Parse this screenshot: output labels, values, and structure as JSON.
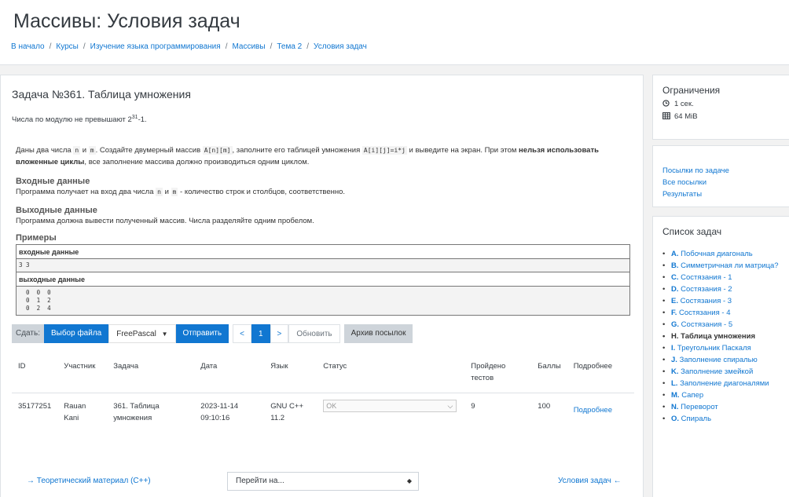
{
  "header": {
    "title": "Массивы: Условия задач",
    "breadcrumb": [
      "В начало",
      "Курсы",
      "Изучение языка программирования",
      "Массивы",
      "Тема 2",
      "Условия задач"
    ]
  },
  "task": {
    "title": "Задача №361. Таблица умножения",
    "note_prefix": "Числа по модулю не превышают 2",
    "note_exp": "31",
    "note_suffix": "-1.",
    "statement_parts": {
      "p1a": "Даны два числа ",
      "n": "n",
      "p1b": " и ",
      "m": "m",
      "p1c": ". Создайте двумерный массив ",
      "arr": "A[n][m]",
      "p1d": ", заполните его таблицей умножения ",
      "formula": "A[i][j]=i*j",
      "p1e": " и выведите на экран. При этом ",
      "bold": "нельзя использовать вложенные циклы",
      "p1f": ", все заполнение массива должно производиться одним циклом."
    },
    "input_title": "Входные данные",
    "input_parts": {
      "a": "Программа получает на вход два числа ",
      "n": "n",
      "b": " и ",
      "m": "m",
      "c": " - количество строк и столбцов, соответственно."
    },
    "output_title": "Выходные данные",
    "output_text": "Программа должна вывести  полученный массив. Числа разделяйте одним пробелом.",
    "examples_title": "Примеры",
    "input_header": "входные данные",
    "input_value": "3 3",
    "output_header": "выходные данные",
    "output_value": "  0  0  0\n  0  1  2\n  0  2  4"
  },
  "submit": {
    "label": "Сдать:",
    "choose_file": "Выбор файла",
    "language": "FreePascal",
    "send": "Отправить",
    "prev": "<",
    "page": "1",
    "next": ">",
    "refresh": "Обновить",
    "archive": "Архив посылок"
  },
  "results": {
    "headers": [
      "ID",
      "Участник",
      "Задача",
      "Дата",
      "Язык",
      "Статус",
      "Пройдено тестов",
      "Баллы",
      "Подробнее"
    ],
    "rows": [
      {
        "id": "35177251",
        "participant": "Rauan Kani",
        "task": "361. Таблица умножения",
        "date": "2023-11-14 09:10:16",
        "lang": "GNU C++ 11.2",
        "status": "OK",
        "tests": "9",
        "score": "100",
        "details": "Подробнее"
      }
    ]
  },
  "nav": {
    "prev": "→ Теоретический материал (C++)",
    "jump": "Перейти на...",
    "next": "Условия задач ←"
  },
  "sidebar": {
    "limits_title": "Ограничения",
    "time": "1 сек.",
    "memory": "64 MiB",
    "links": [
      "Посылки по задаче",
      "Все посылки",
      "Результаты"
    ],
    "tasks_title": "Список задач",
    "tasks": [
      {
        "letter": "A.",
        "name": "Побочная диагональ"
      },
      {
        "letter": "B.",
        "name": "Симметричная ли матрица?"
      },
      {
        "letter": "C.",
        "name": "Состязания - 1"
      },
      {
        "letter": "D.",
        "name": "Состязания - 2"
      },
      {
        "letter": "E.",
        "name": "Состязания - 3"
      },
      {
        "letter": "F.",
        "name": "Состязания - 4"
      },
      {
        "letter": "G.",
        "name": "Состязания - 5"
      },
      {
        "letter": "H.",
        "name": "Таблица умножения"
      },
      {
        "letter": "I.",
        "name": "Треугольник Паскаля"
      },
      {
        "letter": "J.",
        "name": "Заполнение спиралью"
      },
      {
        "letter": "K.",
        "name": "Заполнение змейкой"
      },
      {
        "letter": "L.",
        "name": "Заполнение диагоналями"
      },
      {
        "letter": "M.",
        "name": "Сапер"
      },
      {
        "letter": "N.",
        "name": "Переворот"
      },
      {
        "letter": "O.",
        "name": "Спираль"
      }
    ]
  },
  "colors": {
    "link": "#1177d1",
    "primary": "#1177d1",
    "secondary": "#ced4da"
  },
  "icons": {
    "time": "clock-icon",
    "memory": "table-icon"
  }
}
